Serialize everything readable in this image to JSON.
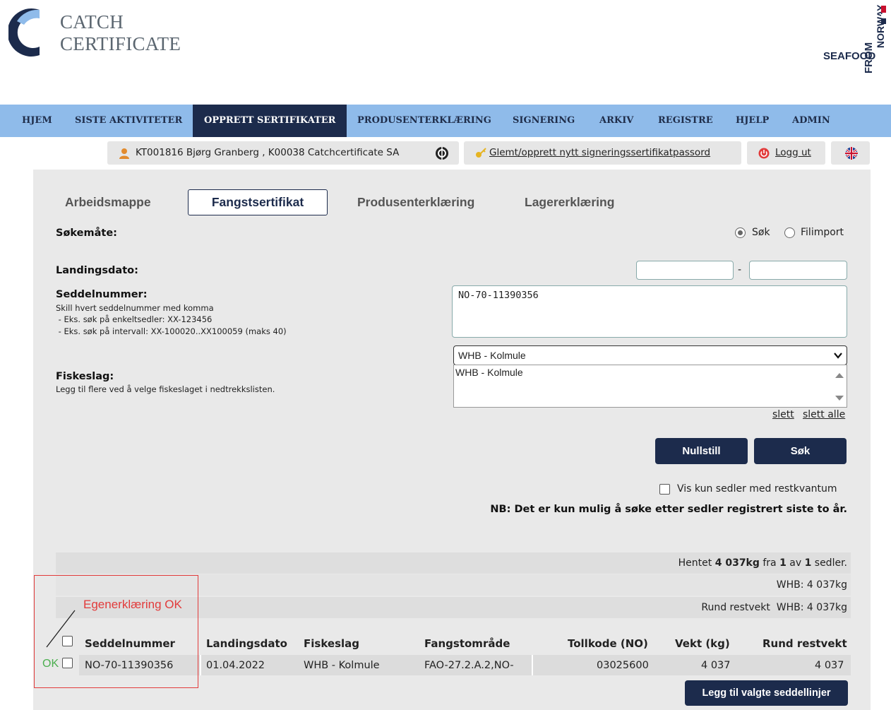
{
  "header": {
    "brand_line1": "CATCH",
    "brand_line2": "CERTIFICATE",
    "partner_logo_word": "SEAFOOD",
    "partner_logo_sub1": "FROM",
    "partner_logo_sub2": "NORWAY"
  },
  "nav": {
    "items": [
      "HJEM",
      "SISTE AKTIVITETER",
      "OPPRETT SERTIFIKATER",
      "PRODUSENTERKLÆRING",
      "SIGNERING",
      "ARKIV",
      "REGISTRE",
      "HJELP",
      "ADMIN"
    ],
    "active": "OPPRETT SERTIFIKATER"
  },
  "userbar": {
    "user": "KT001816 Bjørg Granberg , K00038 Catchcertificate SA",
    "password_link": "Glemt/opprett nytt signeringssertifikatpassord",
    "logout": "Logg ut",
    "icons": [
      "user-icon",
      "globe-icon",
      "key-icon",
      "power-icon",
      "uk-flag-icon"
    ]
  },
  "tabs": [
    "Arbeidsmappe",
    "Fangstsertifikat",
    "Produsenterklæring",
    "Lagererklæring"
  ],
  "active_tab": "Fangstsertifikat",
  "form": {
    "search_mode_label": "Søkemåte:",
    "radio_search": "Søk",
    "radio_import": "Filimport",
    "search_selected": true,
    "landing_date_label": "Landingsdato:",
    "date_from": "",
    "date_to": "",
    "date_separator": "-",
    "note_number_label": "Seddelnummer:",
    "note_number_hint1": "Skill hvert seddelnummer med komma",
    "note_number_hint2": " - Eks. søk på enkeltsedler: XX-123456",
    "note_number_hint3": " - Eks. søk på intervall: XX-100020..XX100059 (maks 40)",
    "note_number_value": "NO-70-11390356",
    "species_label": "Fiskeslag:",
    "species_hint": "Legg til flere ved å velge fiskeslaget i nedtrekkslisten.",
    "species_selected": "WHB - Kolmule",
    "species_list": [
      "WHB - Kolmule"
    ],
    "delete_link": "slett",
    "delete_all_link": "slett alle",
    "reset_button": "Nullstill",
    "search_button": "Søk",
    "rest_only_label": "Vis kun sedler med restkvantum",
    "rest_only_checked": false,
    "notice": "NB: Det er kun mulig å søke etter sedler registrert siste to år."
  },
  "results": {
    "summary_prefix": "Hentet ",
    "summary_weight": "4 037kg",
    "summary_mid": " fra ",
    "summary_count": "1",
    "summary_av": " av ",
    "summary_total": "1",
    "summary_suffix": " sedler.",
    "species_total": "WHB: 4 037kg",
    "round_rest": "Rund restvekt  WHB: 4 037kg",
    "columns": [
      "Seddelnummer",
      "Landingsdato",
      "Fiskeslag",
      "Fangstområde",
      "Tollkode (NO)",
      "Vekt (kg)",
      "Rund restvekt"
    ],
    "rows": [
      {
        "seddelnummer": "NO-70-11390356",
        "landingsdato": "01.04.2022",
        "fiskeslag": "WHB - Kolmule",
        "fangstomrade": "FAO-27.2.A.2,NO-",
        "tollkode": "03025600",
        "vekt": "4 037",
        "rund_restvekt": "4 037",
        "status": "OK",
        "checked": false
      }
    ],
    "add_button": "Legg til valgte seddellinjer"
  },
  "annotation": {
    "label": "Egenerklæring OK",
    "color": "#e23b3b"
  },
  "colors": {
    "nav_bg": "#8fbbea",
    "accent": "#1c2b4c",
    "panel": "#e9e9e9",
    "ok_green": "#4caf50"
  }
}
